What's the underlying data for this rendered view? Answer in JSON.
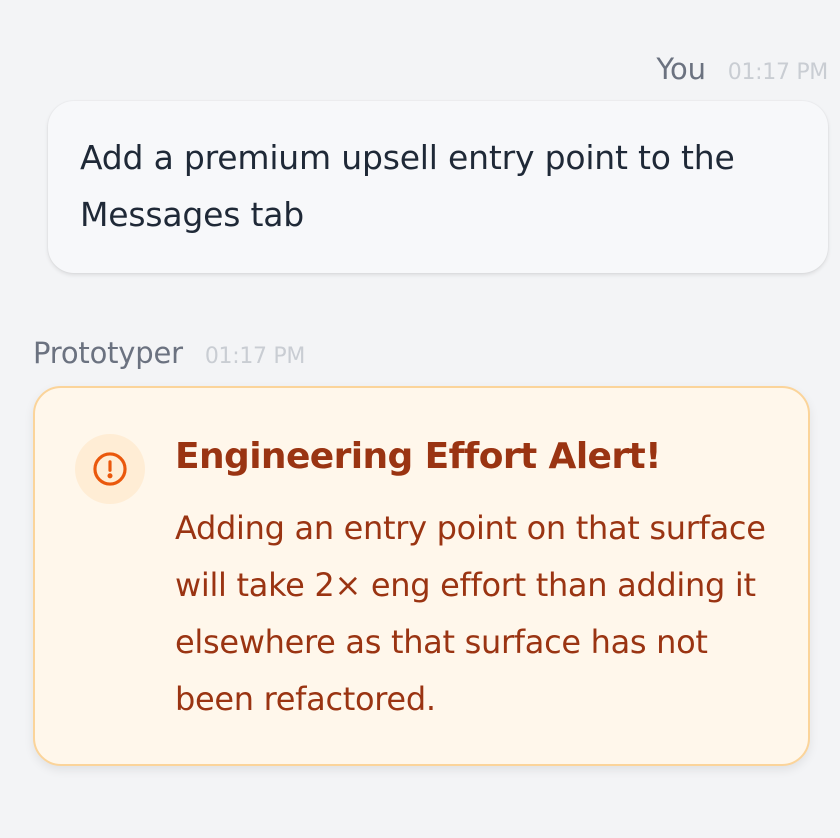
{
  "user_message": {
    "author": "You",
    "timestamp": "01:17 PM",
    "text": "Add a premium upsell entry point to the Messages tab"
  },
  "assistant_message": {
    "author": "Prototyper",
    "timestamp": "01:17 PM",
    "alert": {
      "icon": "alert-circle-icon",
      "title": "Engineering Effort Alert!",
      "body": "Adding an entry point on that surface will take 2× eng effort than adding it elsewhere as that surface has not been refactored."
    }
  },
  "colors": {
    "background": "#f3f4f6",
    "alert_background": "#fff7eb",
    "alert_border": "#fbd49a",
    "alert_text": "#9a3412",
    "alert_icon": "#ea580c"
  }
}
